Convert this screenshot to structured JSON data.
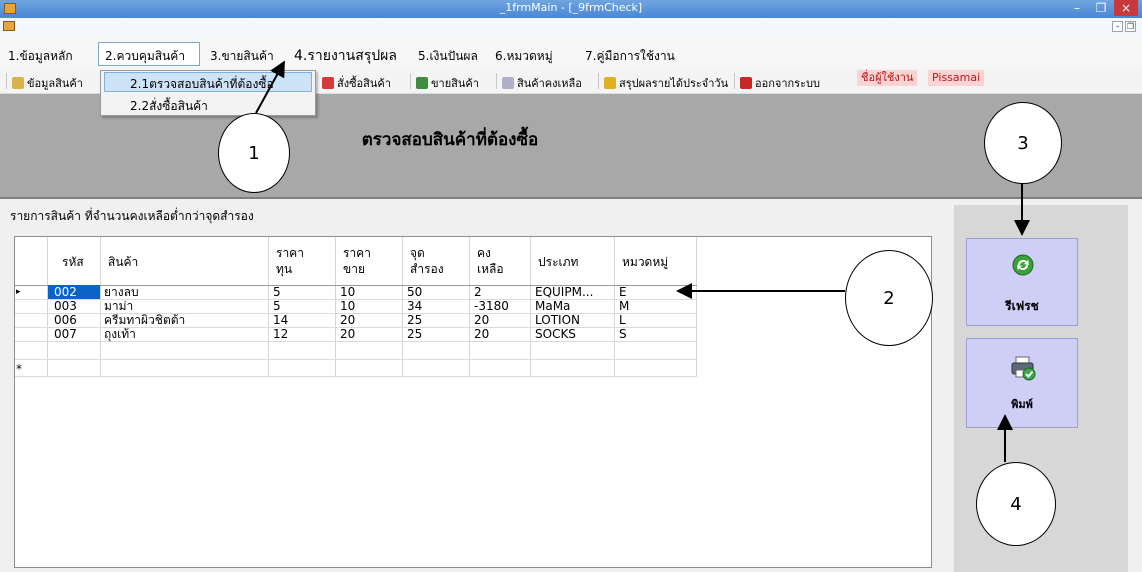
{
  "window": {
    "title": "_1frmMain - [_9frmCheck]",
    "close_glyph": "×",
    "minimize_glyph": "–",
    "restore_glyph": "❐",
    "child_min_glyph": "–",
    "child_restore_glyph": "❐"
  },
  "menu": {
    "items": [
      "1.ข้อมูลหลัก",
      "2.ควบคุมสินค้า",
      "3.ขายสินค้า",
      "4.รายงานสรุปผล",
      "5.เงินปันผล",
      "6.หมวดหมู่",
      "7.คู่มือการใช้งาน"
    ]
  },
  "dropdown": {
    "items": [
      "2.1ตรวจสอบสินค้าที่ต้องซื้อ",
      "2.2สั่งซื้อสินค้า"
    ]
  },
  "toolbar": {
    "items": [
      "ข้อมูลสินค้า",
      "สั่งซื้อสินค้า",
      "ขายสินค้า",
      "สินค้าคงเหลือ",
      "สรุปผลรายได้ประจำวัน",
      "ออกจากระบบ"
    ],
    "user_label": "ชื่อผู้ใช้งาน",
    "user_name": "Pissamai"
  },
  "page": {
    "title": "ตรวจสอบสินค้าที่ต้องซื้อ",
    "list_caption": "รายการสินค้า ที่จำนวนคงเหลือต่ำกว่าจุดสำรอง"
  },
  "grid": {
    "columns": [
      [
        "รหัส",
        ""
      ],
      [
        "สินค้า",
        ""
      ],
      [
        "ราคา",
        "ทุน"
      ],
      [
        "ราคา",
        "ขาย"
      ],
      [
        "จุด",
        "สำรอง"
      ],
      [
        "คง",
        "เหลือ"
      ],
      [
        "ประเภท",
        ""
      ],
      [
        "หมวดหมู่",
        ""
      ]
    ],
    "rows": [
      [
        "002",
        "ยางลบ",
        "5",
        "10",
        "50",
        "2",
        "EQUIPM...",
        "E"
      ],
      [
        "003",
        "มาม่า",
        "5",
        "10",
        "34",
        "-3180",
        "MaMa",
        "M"
      ],
      [
        "006",
        "ครีมทาผิวชิตต้า",
        "14",
        "20",
        "25",
        "20",
        "LOTION",
        "L"
      ],
      [
        "007",
        "ถุงเท้า",
        "12",
        "20",
        "25",
        "20",
        "SOCKS",
        "S"
      ]
    ],
    "current_row_glyph": "▸",
    "new_row_glyph": "*"
  },
  "buttons": {
    "refresh": "รีเฟรช",
    "print": "พิมพ์"
  },
  "annotations": [
    "1",
    "2",
    "3",
    "4"
  ],
  "colors": {
    "selected_cell": "#0a64c8",
    "header_band": "#a8a8a8",
    "action_button": "#cecef7",
    "user_badge": "#fbd3d3"
  }
}
